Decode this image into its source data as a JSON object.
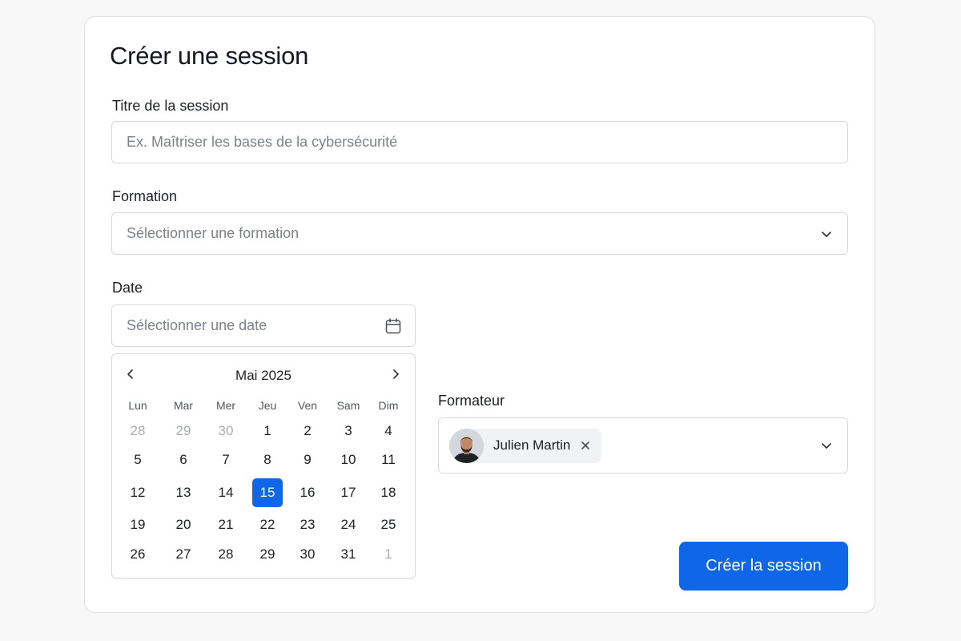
{
  "form": {
    "title": "Créer une session",
    "session_title": {
      "label": "Titre de la session",
      "placeholder": "Ex. Maîtriser les bases de la cybersécurité"
    },
    "formation": {
      "label": "Formation",
      "placeholder": "Sélectionner une formation",
      "icon": "chevron-down-icon"
    },
    "date": {
      "label": "Date",
      "placeholder": "Sélectionner une date",
      "icon": "calendar-icon"
    },
    "trainer": {
      "label": "Formateur",
      "selected_name": "Julien Martin",
      "icon": "chevron-down-icon"
    },
    "submit_label": "Créer la session"
  },
  "calendar": {
    "month_label": "Mai 2025",
    "weekdays": [
      "Lun",
      "Mar",
      "Mer",
      "Jeu",
      "Ven",
      "Sam",
      "Dim"
    ],
    "weeks": [
      [
        "28",
        "29",
        "30",
        "1",
        "2",
        "3",
        "4"
      ],
      [
        "5",
        "6",
        "7",
        "8",
        "9",
        "10",
        "11"
      ],
      [
        "12",
        "13",
        "14",
        "15",
        "16",
        "17",
        "18"
      ],
      [
        "19",
        "20",
        "21",
        "22",
        "23",
        "24",
        "25"
      ],
      [
        "26",
        "27",
        "28",
        "29",
        "30",
        "31",
        "1"
      ]
    ],
    "selected_day": "15",
    "colors": {
      "selected_bg": "#0f67e8",
      "muted_text": "#a8acb4"
    }
  },
  "colors": {
    "primary": "#0f67e8",
    "border": "#d6d9de",
    "placeholder": "#7c818b"
  }
}
